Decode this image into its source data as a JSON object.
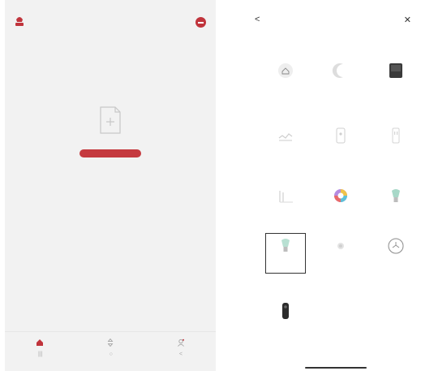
{
  "left": {
    "status": {
      "time": "",
      "right": ""
    },
    "empty": {
      "message": "",
      "button_label": ""
    },
    "nav": {
      "items": [
        {
          "label": "",
          "icon": "home-icon",
          "active": true
        },
        {
          "label": "",
          "icon": "scenes-icon",
          "active": false
        },
        {
          "label": "",
          "icon": "me-icon",
          "active": false
        }
      ]
    },
    "sys_nav": [
      "|||",
      "○",
      "<"
    ]
  },
  "right": {
    "status": {
      "time": "",
      "right": ""
    },
    "header": {
      "title": "",
      "back_glyph": "<",
      "close_glyph": "✕"
    },
    "devices": [
      {
        "label": "",
        "icon": "home-sensor-icon"
      },
      {
        "label": "",
        "icon": "moon-sensor-icon"
      },
      {
        "label": "",
        "icon": "dark-panel-icon"
      },
      {
        "label": "",
        "icon": "light-switch-icon"
      },
      {
        "label": "",
        "icon": "plug-icon"
      },
      {
        "label": "",
        "icon": "outlet-icon"
      },
      {
        "label": "",
        "icon": "strip-light-icon"
      },
      {
        "label": "",
        "icon": "color-bulb-icon"
      },
      {
        "label": "",
        "icon": "bulb-icon"
      },
      {
        "label": "",
        "icon": "bulb-icon"
      },
      {
        "label": "",
        "icon": "spot-light-icon"
      },
      {
        "label": "",
        "icon": "ceiling-light-icon"
      },
      {
        "label": "",
        "icon": "doorbell-icon"
      }
    ]
  },
  "accent": "#c0343c"
}
